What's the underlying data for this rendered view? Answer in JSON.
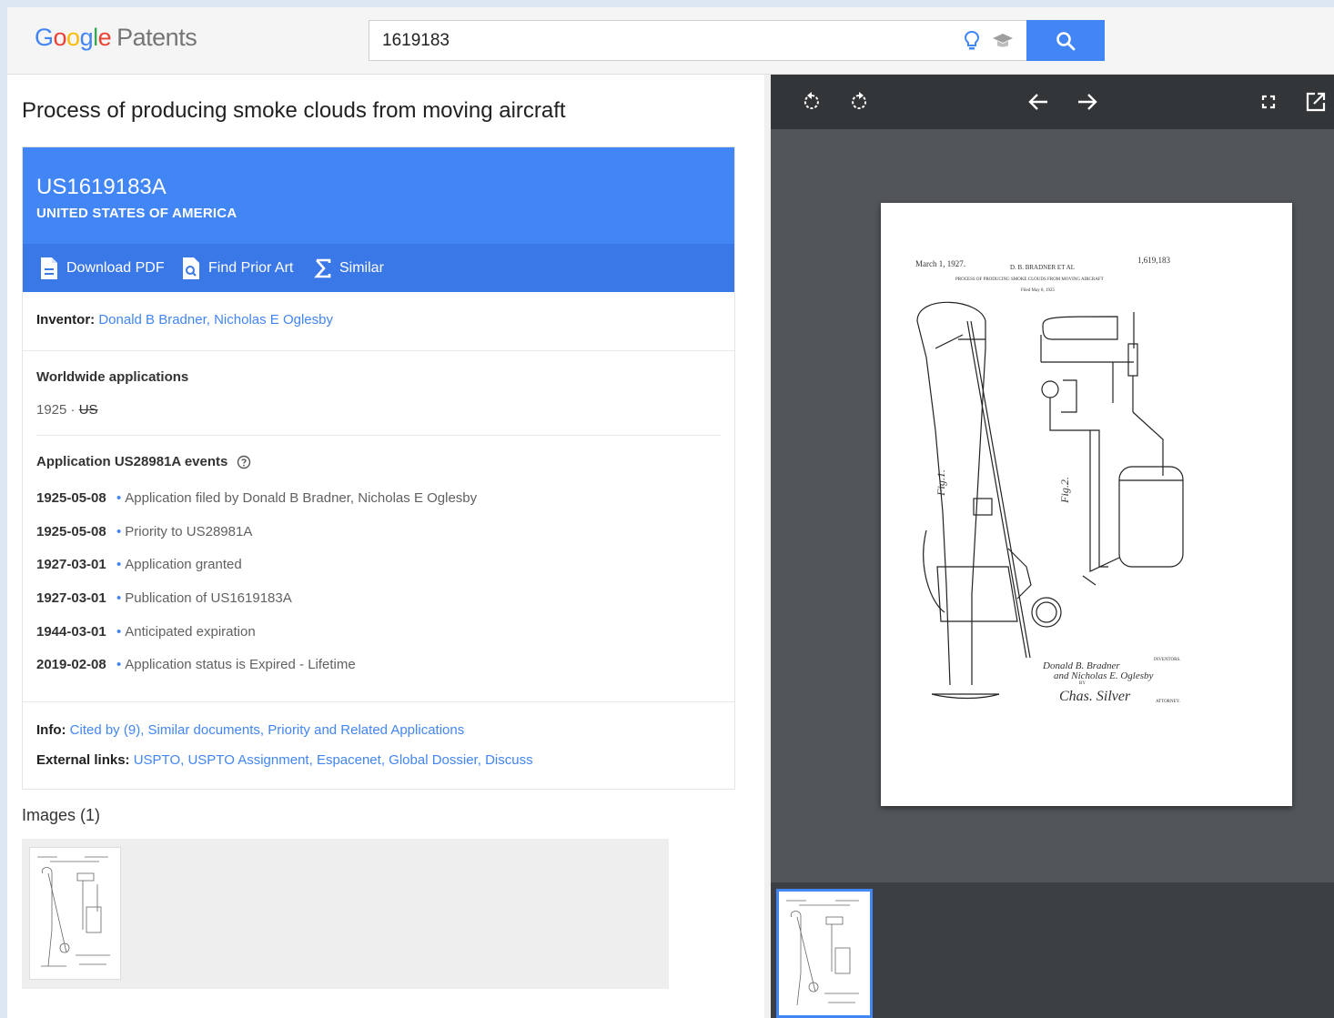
{
  "header": {
    "logo": {
      "brand": [
        "G",
        "o",
        "o",
        "g",
        "l",
        "e"
      ],
      "product": "Patents"
    },
    "search": {
      "value": "1619183",
      "placeholder": ""
    },
    "icons": [
      "lightbulb-icon",
      "graduation-cap-icon",
      "search-icon"
    ]
  },
  "patent": {
    "title": "Process of producing smoke clouds from moving aircraft",
    "number": "US1619183A",
    "country": "UNITED STATES OF AMERICA",
    "actions": [
      {
        "label": "Download PDF",
        "icon": "pdf-file-icon"
      },
      {
        "label": "Find Prior Art",
        "icon": "find-document-icon"
      },
      {
        "label": "Similar",
        "icon": "sigma-icon"
      }
    ],
    "inventor_label": "Inventor:",
    "inventors": "Donald B Bradner, Nicholas E Oglesby",
    "worldwide": {
      "heading": "Worldwide applications",
      "year": "1925",
      "separator": "·",
      "country": "US"
    },
    "events_heading": "Application US28981A events",
    "events": [
      {
        "date": "1925-05-08",
        "desc": "Application filed by Donald B Bradner, Nicholas E Oglesby"
      },
      {
        "date": "1925-05-08",
        "desc": "Priority to US28981A"
      },
      {
        "date": "1927-03-01",
        "desc": "Application granted"
      },
      {
        "date": "1927-03-01",
        "desc": "Publication of US1619183A"
      },
      {
        "date": "1944-03-01",
        "desc": "Anticipated expiration"
      },
      {
        "date": "2019-02-08",
        "desc": "Application status is Expired - Lifetime"
      }
    ],
    "info_label": "Info:",
    "info_links": [
      "Cited by (9)",
      "Similar documents",
      "Priority and Related Applications"
    ],
    "external_label": "External links:",
    "external_links": [
      "USPTO",
      "USPTO Assignment",
      "Espacenet",
      "Global Dossier",
      "Discuss"
    ],
    "images_heading": "Images (1)"
  },
  "viewer": {
    "toolbar": [
      "rotate-left-icon",
      "rotate-right-icon",
      "arrow-left-icon",
      "arrow-right-icon",
      "fullscreen-icon",
      "open-external-icon"
    ],
    "page": {
      "date": "March 1, 1927.",
      "inventors": "D. B. BRADNER ET AL",
      "number": "1,619,183",
      "title": "PROCESS OF PRODUCING SMOKE CLOUDS FROM MOVING AIRCRAFT",
      "filed": "Filed May 8, 1925",
      "fig1": "Fig.1.",
      "fig2": "Fig.2.",
      "sig1": "Donald B. Bradner",
      "sig2": "and Nicholas E. Oglesby",
      "sig3": "Chas. Silver",
      "inventors_label": "INVENTORS.",
      "by": "BY",
      "attorney_label": "ATTORNEY."
    }
  },
  "colors": {
    "accent": "#4285f4",
    "accent_dark": "#3b78e7",
    "viewer_bg": "#525659",
    "toolbar_bg": "#323639"
  }
}
